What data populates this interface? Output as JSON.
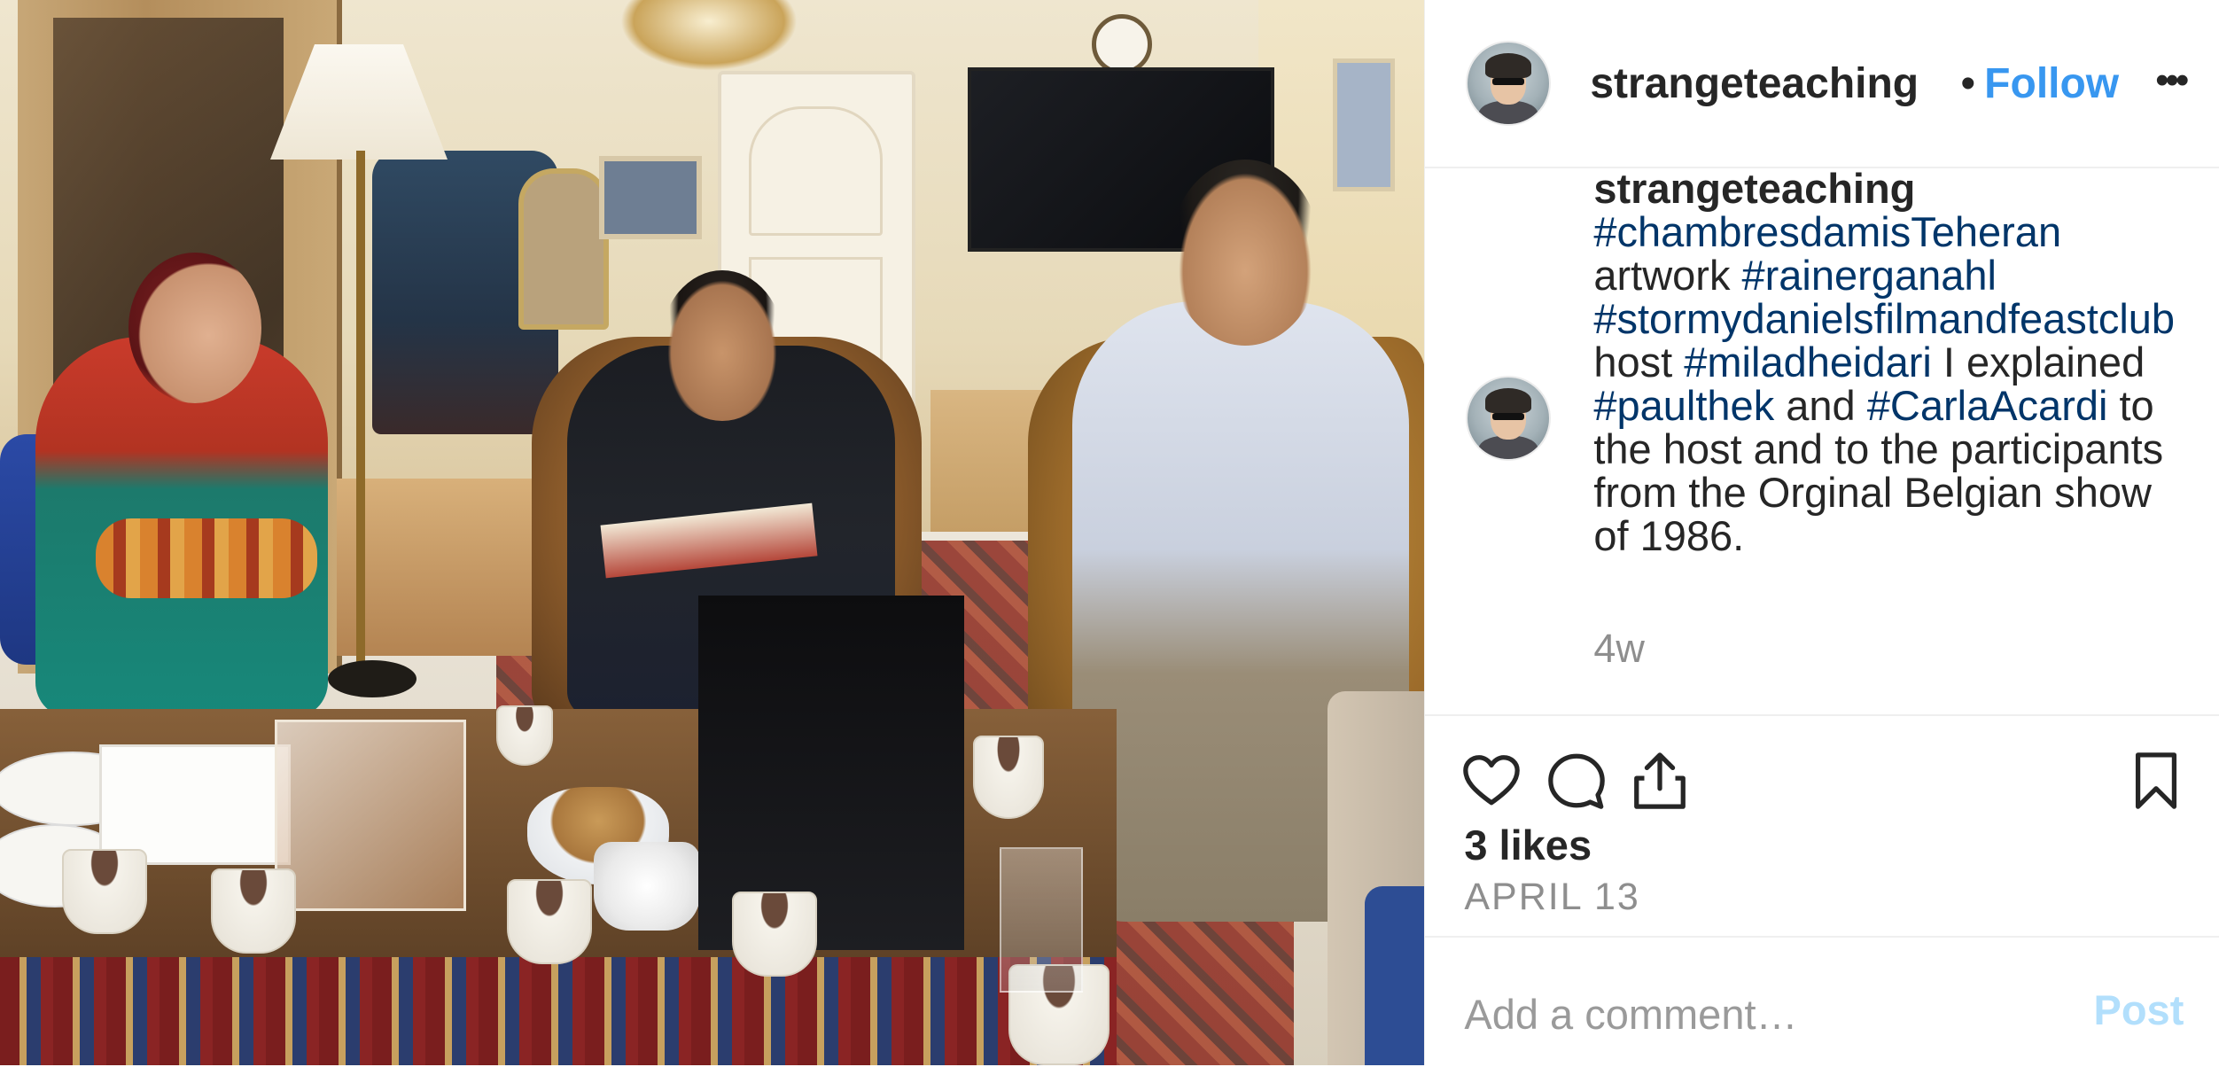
{
  "post": {
    "username": "strangeteaching",
    "separator": "•",
    "follow_label": "Follow",
    "more_label": "•••"
  },
  "caption": {
    "username": "strangeteaching",
    "segments": [
      {
        "text": "#chambresdamisTeheran",
        "type": "hashtag"
      },
      {
        "text": " artwork ",
        "type": "text"
      },
      {
        "text": "#rainerganahl",
        "type": "hashtag"
      },
      {
        "text": " ",
        "type": "text"
      },
      {
        "text": "#stormydanielsfilmandfeastclub",
        "type": "hashtag"
      },
      {
        "text": " host ",
        "type": "text"
      },
      {
        "text": "#miladheidari",
        "type": "hashtag"
      },
      {
        "text": " I explained ",
        "type": "text"
      },
      {
        "text": "#paulthek",
        "type": "hashtag"
      },
      {
        "text": " and ",
        "type": "text"
      },
      {
        "text": "#CarlaAcardi",
        "type": "hashtag"
      },
      {
        "text": " to the host and to the participants from the Orginal Belgian show of 1986.",
        "type": "text"
      }
    ],
    "time_ago": "4w"
  },
  "actions": {
    "like_icon": "heart-icon",
    "comment_icon": "comment-icon",
    "share_icon": "share-icon",
    "save_icon": "bookmark-icon"
  },
  "likes_label": "3 likes",
  "date_label": "APRIL 13",
  "comment": {
    "placeholder": "Add a comment…",
    "value": "",
    "post_label": "Post"
  },
  "colors": {
    "follow": "#3897f0",
    "hashtag": "#003569",
    "post_disabled": "#b2dffc",
    "muted": "#8e8e8e"
  }
}
